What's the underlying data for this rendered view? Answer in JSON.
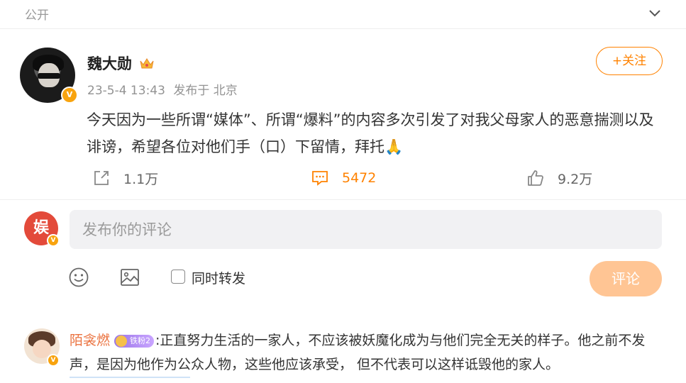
{
  "header": {
    "visibility_label": "公开"
  },
  "post": {
    "author_name": "魏大勋",
    "verified_mark": "V",
    "timestamp": "23-5-4 13:43",
    "published_from": "发布于 北京",
    "follow_label": "+关注",
    "content": "今天因为一些所谓“媒体”、所谓“爆料”的内容多次引发了对我父母家人的恶意揣测以及诽谤，希望各位对他们手（口）下留情，拜托🙏",
    "reposts": "1.1万",
    "comments": "5472",
    "likes": "9.2万"
  },
  "composer": {
    "avatar_text": "娱",
    "placeholder": "发布你的评论",
    "repost_label": "同时转发",
    "submit_label": "评论",
    "accent": "#ff8200"
  },
  "comments": [
    {
      "name": "陌衾燃",
      "fan_badge": "铁粉2",
      "text": ":正直努力生活的一家人，不应该被妖魔化成为与他们完全无关的样子。他之前不发声，是因为他作为公众人物，这些他应该承受， 但不代表可以这样诋毁他的家人。"
    }
  ]
}
